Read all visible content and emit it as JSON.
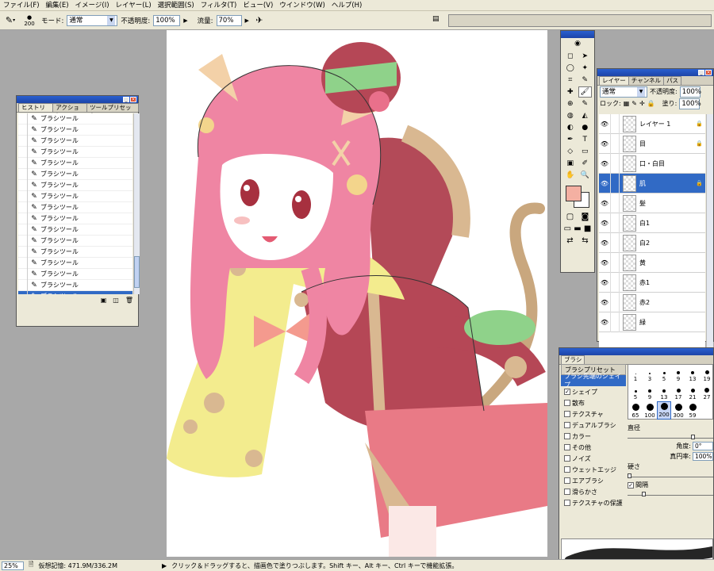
{
  "menu": [
    "ファイル(F)",
    "編集(E)",
    "イメージ(I)",
    "レイヤー(L)",
    "選択範囲(S)",
    "フィルタ(T)",
    "ビュー(V)",
    "ウインドウ(W)",
    "ヘルプ(H)"
  ],
  "options": {
    "brush_size": "200",
    "mode_label": "モード:",
    "mode_value": "通常",
    "opacity_label": "不透明度:",
    "opacity_value": "100%",
    "flow_label": "流量:",
    "flow_value": "70%"
  },
  "history": {
    "tabs": [
      "ヒストリー",
      "アクション",
      "ツールプリセット"
    ],
    "items": [
      "ブラシツール",
      "ブラシツール",
      "ブラシツール",
      "ブラシツール",
      "ブラシツール",
      "ブラシツール",
      "ブラシツール",
      "ブラシツール",
      "ブラシツール",
      "ブラシツール",
      "ブラシツール",
      "ブラシツール",
      "ブラシツール",
      "ブラシツール",
      "ブラシツール",
      "ブラシツール",
      "ブラシツール"
    ],
    "selected_index": 16
  },
  "toolbox": {
    "tools": [
      "◻",
      "➤",
      "◯",
      "✦",
      "⌗",
      "✎",
      "✚",
      "🖌",
      "⊕",
      "✎",
      "◍",
      "◭",
      "◐",
      "●",
      "✒",
      "T",
      "◇",
      "▭",
      "▣",
      "✐",
      "✋",
      "🔍"
    ],
    "fg_color": "#f4b0a2",
    "bg_color": "#ffffff"
  },
  "layers": {
    "tabs": [
      "レイヤー",
      "チャンネル",
      "パス"
    ],
    "blend_mode": "通常",
    "opacity_label": "不透明度:",
    "opacity_value": "100%",
    "lock_label": "ロック:",
    "fill_label": "塗り:",
    "fill_value": "100%",
    "items": [
      {
        "name": "レイヤー 1",
        "locked": true
      },
      {
        "name": "目",
        "locked": true
      },
      {
        "name": "口・白目",
        "locked": false
      },
      {
        "name": "肌",
        "locked": true
      },
      {
        "name": "髪",
        "locked": false
      },
      {
        "name": "白1",
        "locked": false
      },
      {
        "name": "白2",
        "locked": false
      },
      {
        "name": "黄",
        "locked": false
      },
      {
        "name": "赤1",
        "locked": false
      },
      {
        "name": "赤2",
        "locked": false
      },
      {
        "name": "緑",
        "locked": false
      }
    ],
    "selected_index": 3
  },
  "brushes": {
    "title": "ブラシ",
    "options": [
      {
        "label": "ブラシプリセット",
        "type": "header"
      },
      {
        "label": "ブラシ先端のシェイプ",
        "type": "active"
      },
      {
        "label": "シェイプ",
        "checked": true
      },
      {
        "label": "散布",
        "checked": false
      },
      {
        "label": "テクスチャ",
        "checked": false
      },
      {
        "label": "デュアルブラシ",
        "checked": false
      },
      {
        "label": "カラー",
        "checked": false
      },
      {
        "label": "その他",
        "checked": false
      },
      {
        "label": "ノイズ",
        "checked": false
      },
      {
        "label": "ウェットエッジ",
        "checked": false
      },
      {
        "label": "エアブラシ",
        "checked": false
      },
      {
        "label": "滑らかさ",
        "checked": false
      },
      {
        "label": "テクスチャの保護",
        "checked": false
      }
    ],
    "sizes": [
      "1",
      "3",
      "5",
      "9",
      "13",
      "19",
      "5",
      "9",
      "13",
      "17",
      "21",
      "27",
      "65",
      "100",
      "200",
      "300",
      "59",
      ""
    ],
    "selected_size_index": 14,
    "diameter_label": "直径",
    "angle_label": "角度:",
    "angle_value": "0°",
    "roundness_label": "真円率:",
    "roundness_value": "100%",
    "hardness_label": "硬さ",
    "spacing_label": "間隔",
    "spacing_checked": true
  },
  "status": {
    "zoom": "25%",
    "memory": "仮想記憶: 471.9M/336.2M",
    "hint": "クリック＆ドラッグすると、描画色で塗りつぶします。Shift キー、Alt キー、Ctrl キーで機能拡張。"
  }
}
